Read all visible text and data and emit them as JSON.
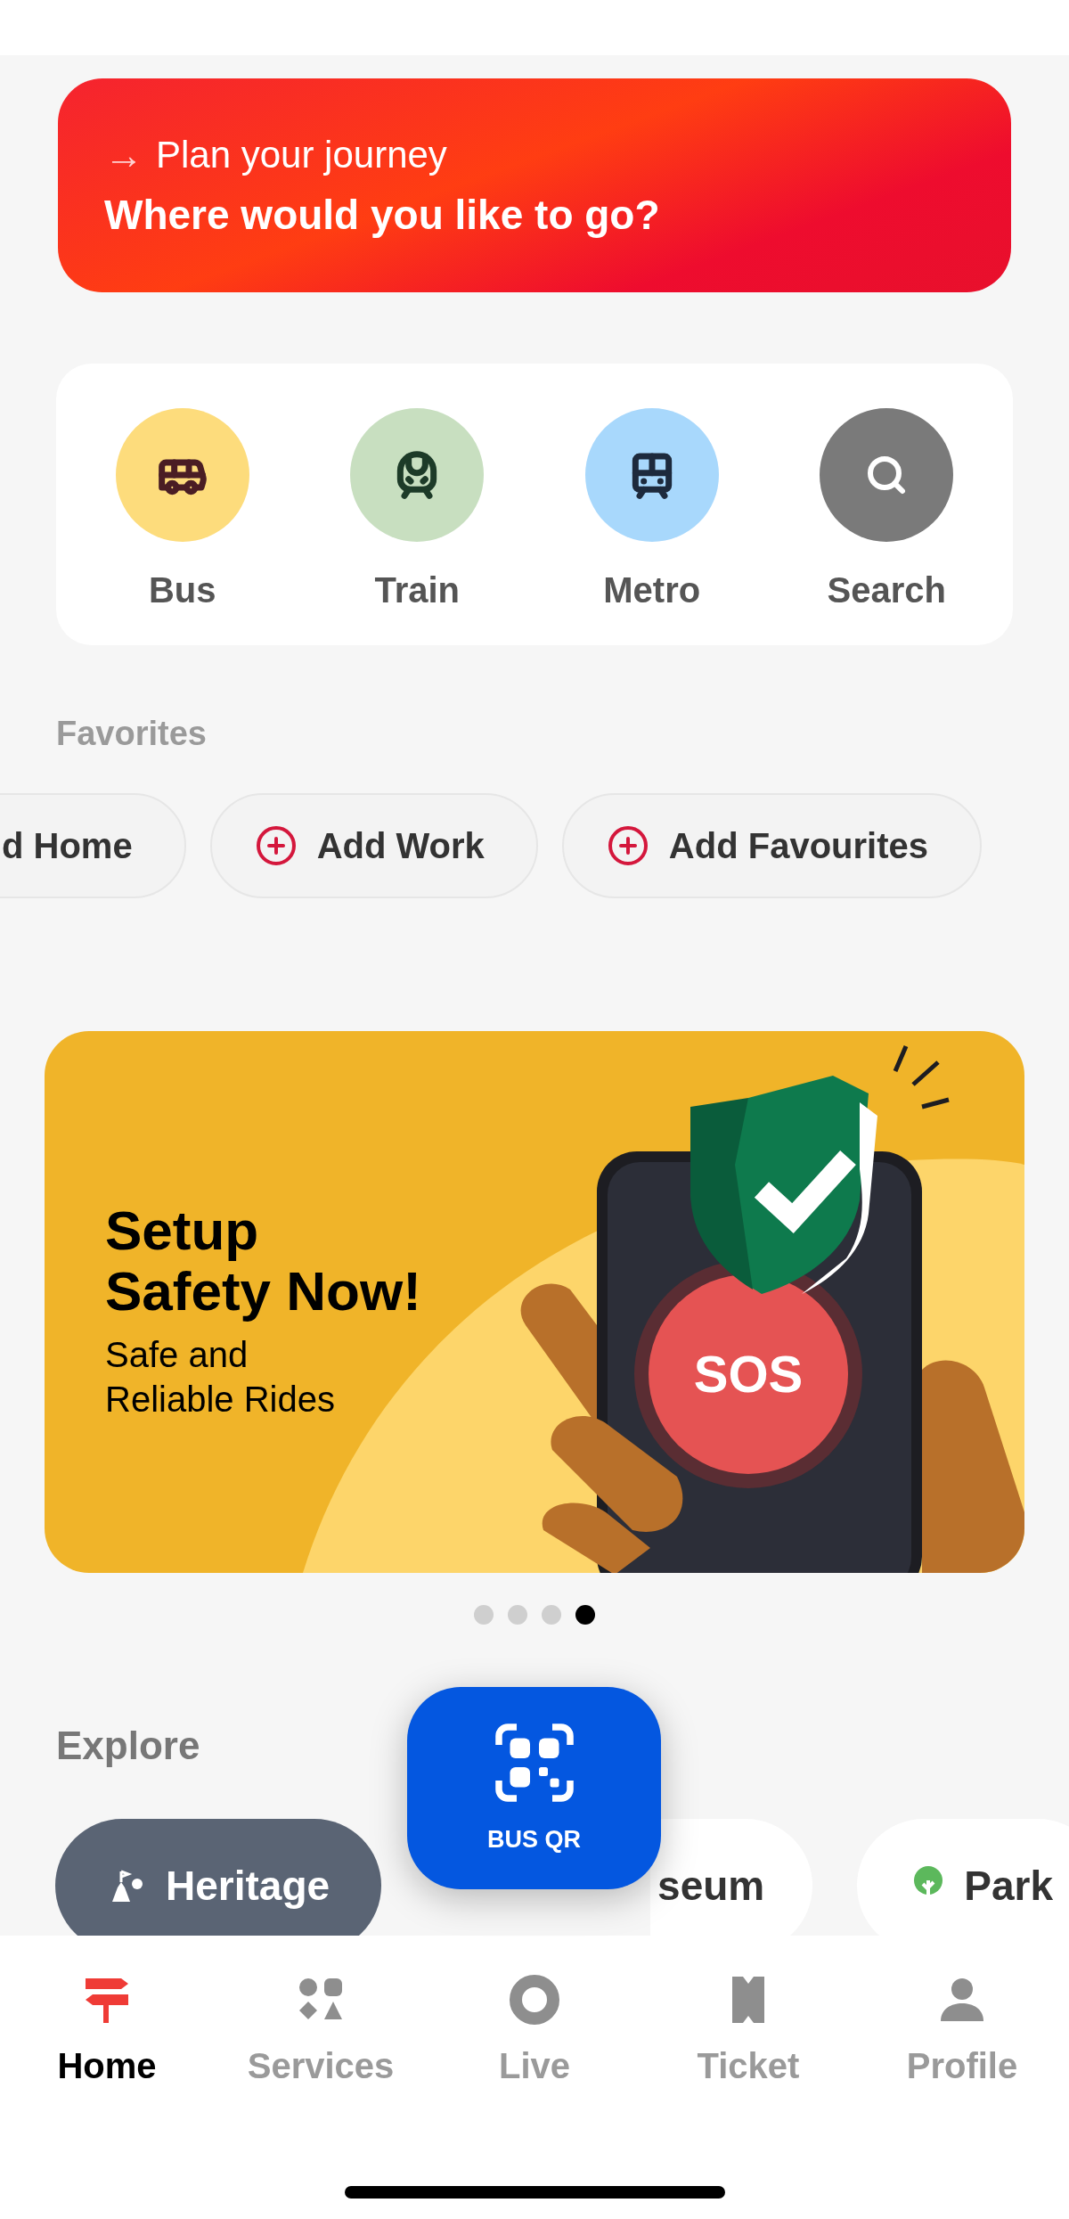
{
  "journey_card": {
    "arrow": "→",
    "title": "Plan your journey",
    "prompt": "Where would you like to go?"
  },
  "modes": [
    {
      "label": "Bus",
      "color": "#fddc7c"
    },
    {
      "label": "Train",
      "color": "#c8dfc0"
    },
    {
      "label": "Metro",
      "color": "#a8d8fc"
    },
    {
      "label": "Search",
      "color": "#7a7a7a"
    }
  ],
  "favorites": {
    "heading": "Favorites",
    "chips": [
      {
        "label": "d Home",
        "kind": "cut"
      },
      {
        "label": "Add Work",
        "kind": "add"
      },
      {
        "label": "Add Favourites",
        "kind": "add"
      }
    ]
  },
  "banner": {
    "title_lines": [
      "Setup",
      "Safety Now!"
    ],
    "subtitle_lines": [
      "Safe and",
      "Reliable Rides"
    ],
    "sos": "SOS"
  },
  "carousel_dots": [
    {
      "selected": false
    },
    {
      "selected": false
    },
    {
      "selected": false
    },
    {
      "selected": true
    }
  ],
  "explore": {
    "heading": "Explore",
    "chips": [
      {
        "label": "Heritage",
        "selected": true
      },
      {
        "label": "seum",
        "selected": false,
        "kind": "cut"
      },
      {
        "label": "Park",
        "selected": false
      }
    ]
  },
  "bus_qr": {
    "label": "BUS QR"
  },
  "bottom_nav": [
    {
      "label": "Home",
      "selected": true
    },
    {
      "label": "Services",
      "selected": false
    },
    {
      "label": "Live",
      "selected": false
    },
    {
      "label": "Ticket",
      "selected": false
    },
    {
      "label": "Profile",
      "selected": false
    }
  ]
}
